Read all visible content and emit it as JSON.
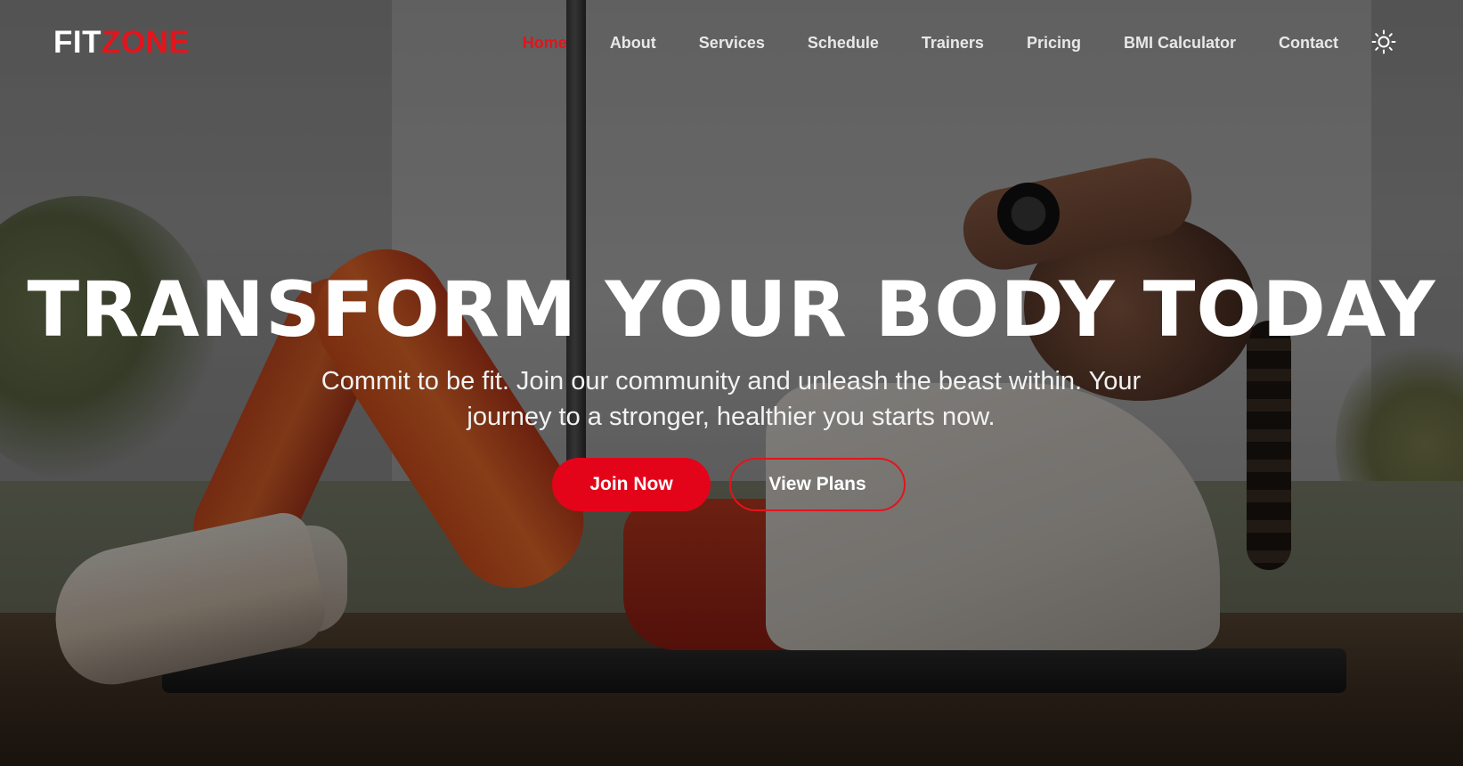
{
  "brand": {
    "logo_part1": "FIT",
    "logo_part2": "ZONE",
    "accent_color": "#e3141c"
  },
  "nav": {
    "items": [
      {
        "label": "Home",
        "active": true
      },
      {
        "label": "About",
        "active": false
      },
      {
        "label": "Services",
        "active": false
      },
      {
        "label": "Schedule",
        "active": false
      },
      {
        "label": "Trainers",
        "active": false
      },
      {
        "label": "Pricing",
        "active": false
      },
      {
        "label": "BMI Calculator",
        "active": false
      },
      {
        "label": "Contact",
        "active": false
      }
    ],
    "theme_toggle_icon": "sun-icon"
  },
  "hero": {
    "headline": "TRANSFORM YOUR BODY TODAY",
    "subtitle": "Commit to be fit. Join our community and unleash the beast within. Your journey to a stronger, healthier you starts now.",
    "primary_button": "Join Now",
    "secondary_button": "View Plans",
    "background_image": "woman doing crunches on a mat"
  }
}
